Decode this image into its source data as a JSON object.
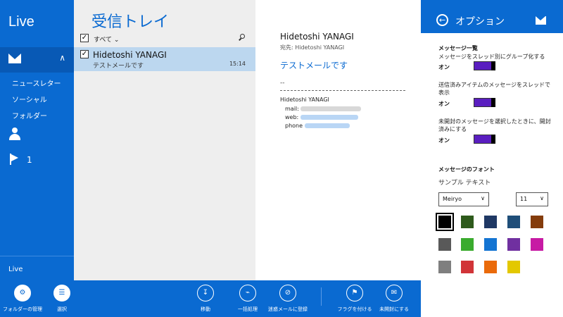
{
  "nav": {
    "app_title": "Live",
    "folders": [
      "ニュースレター",
      "ソーシャル",
      "フォルダー"
    ],
    "flag_count": "1",
    "account": "Live"
  },
  "list": {
    "title": "受信トレイ",
    "filter_label": "すべて ⌄",
    "messages": [
      {
        "sender": "Hidetoshi YANAGI",
        "subject": "テストメールです",
        "time": "15:14"
      }
    ]
  },
  "reader": {
    "from": "Hidetoshi YANAGI",
    "to": "宛先: Hidetoshi YANAGI",
    "subject": "テストメールです",
    "separator": "--",
    "signature_name": "Hidetoshi YANAGI",
    "sig_mail_label": "mail:",
    "sig_web_label": "web:",
    "sig_phone_label": "phone"
  },
  "options": {
    "title": "オプション",
    "section_messages": "メッセージ一覧",
    "settings": [
      {
        "label": "メッセージをスレッド別にグループ化する",
        "state": "オン"
      },
      {
        "label": "送信済みアイテムのメッセージをスレッドで表示",
        "state": "オン"
      },
      {
        "label": "未開封のメッセージを選択したときに、開封済みにする",
        "state": "オン"
      }
    ],
    "section_font": "メッセージのフォント",
    "sample_text": "サンプル テキスト",
    "font_family": "Meiryo",
    "font_size": "11",
    "swatches": [
      "#000000",
      "#2e5a1c",
      "#1f3864",
      "#1f4e79",
      "#843c0c",
      "#595959",
      "#3aab2e",
      "#1474d2",
      "#7030a0",
      "#c71aa4",
      "#7f7f7f",
      "#d13438",
      "#ea6a0a",
      "#e3c800"
    ]
  },
  "appbar": {
    "commands": [
      "フォルダーの管理",
      "選択",
      "移動",
      "一括処理",
      "迷惑メールに登録",
      "フラグを付ける",
      "未開封にする"
    ]
  },
  "colors": {
    "accent": "#0a6ad1",
    "selection": "#bcd7ef",
    "toggle_on": "#5a1ec0"
  }
}
